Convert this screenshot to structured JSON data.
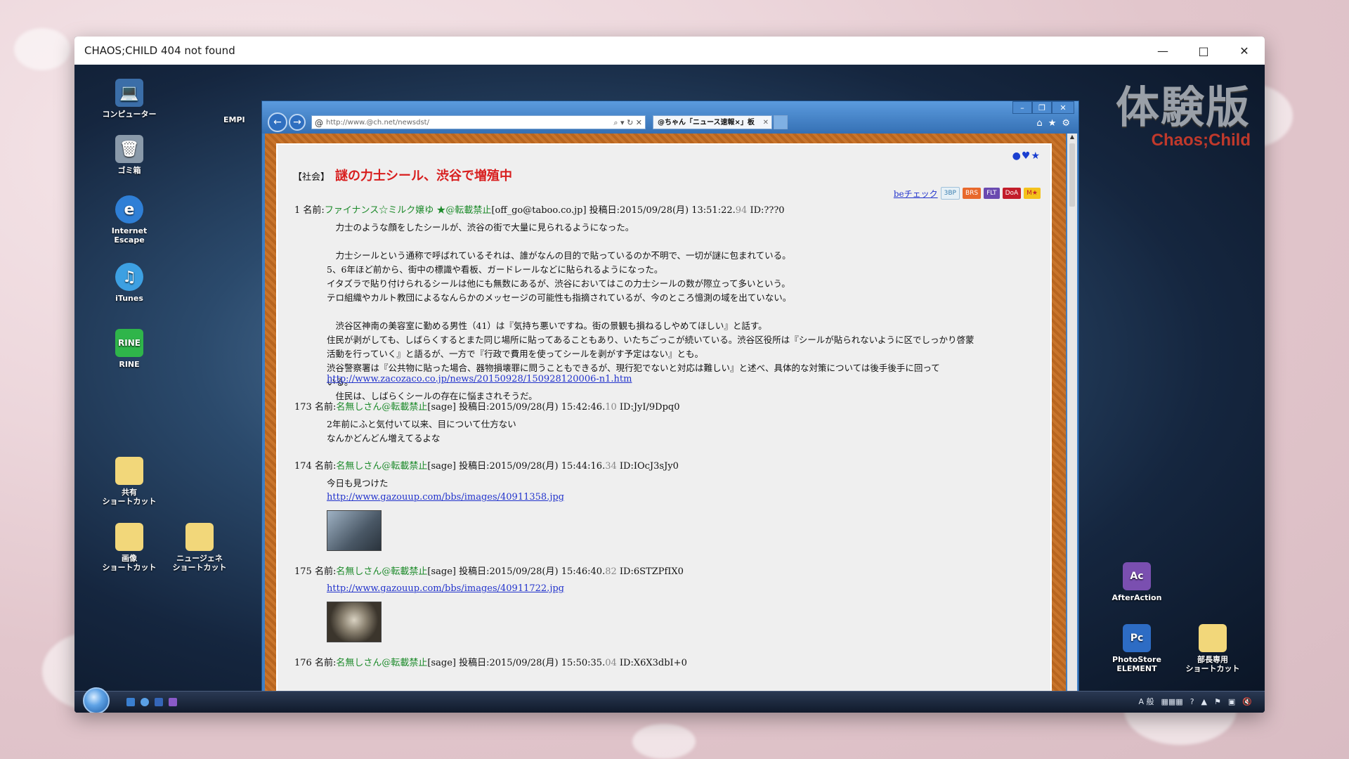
{
  "window": {
    "title": "CHAOS;CHILD 404 not found"
  },
  "watermark": {
    "main": "体験版",
    "sub": "Chaos;Child"
  },
  "desktop_icons": [
    {
      "label": "コンピューター",
      "icon": "computer-icon"
    },
    {
      "label": "ゴミ箱",
      "icon": "trash-icon"
    },
    {
      "label": "Internet Escape",
      "icon": "browser-icon"
    },
    {
      "label": "iTunes",
      "icon": "music-icon"
    },
    {
      "label": "RINE",
      "icon": "chat-icon"
    },
    {
      "label": "共有\nショートカット",
      "icon": "folder-icon"
    },
    {
      "label": "画像\nショートカット",
      "icon": "folder-icon"
    },
    {
      "label": "ニュージェネ\nショートカット",
      "icon": "folder-icon"
    },
    {
      "label": "EMPI",
      "icon": "folder-icon"
    },
    {
      "label": "AfterAction",
      "icon": "app-icon"
    },
    {
      "label": "PhotoStore\nELEMENT",
      "icon": "app-icon"
    },
    {
      "label": "部長専用\nショートカット",
      "icon": "folder-icon"
    }
  ],
  "browser": {
    "address": "http://www.@ch.net/newsdst/",
    "tab_label": "@ちゃん「ニュース速報×」板",
    "page": {
      "category": "【社会】",
      "title": "謎の力士シール、渋谷で増殖中",
      "be_check": "beチェック",
      "badges": [
        "3BP",
        "BRS",
        "FLT",
        "DoA",
        "M★"
      ],
      "posts": [
        {
          "num": "1",
          "name_label": "名前:",
          "name": "ファイナンス☆ミルク嬢ゆ ★@転載禁止",
          "mail": "[off_go@taboo.co.jp]",
          "date": "投稿日:2015/09/28(月) 13:51:22.",
          "sec": "94",
          "id": "ID:???0",
          "body": "　力士のような顔をしたシールが、渋谷の街で大量に見られるようになった。\n\n　力士シールという通称で呼ばれているそれは、誰がなんの目的で貼っているのか不明で、一切が謎に包まれている。\n5、6年ほど前から、街中の標識や看板、ガードレールなどに貼られるようになった。\nイタズラで貼り付けられるシールは他にも無数にあるが、渋谷においてはこの力士シールの数が際立って多いという。\nテロ組織やカルト教団によるなんらかのメッセージの可能性も指摘されているが、今のところ憶測の域を出ていない。\n\n　渋谷区神南の美容室に勤める男性（41）は『気持ち悪いですね。街の景観も損ねるしやめてほしい』と話す。\n住民が剥がしても、しばらくするとまた同じ場所に貼ってあることもあり、いたちごっこが続いている。渋谷区役所は『シールが貼られないように区でしっかり啓蒙\n活動を行っていく』と語るが、一方で『行政で費用を使ってシールを剥がす予定はない』とも。\n渋谷警察署は『公共物に貼った場合、器物損壊罪に問うこともできるが、現行犯でないと対応は難しい』と述べ、具体的な対策については後手後手に回って\nいる。\n　住民は、しばらくシールの存在に悩まされそうだ。",
          "link": "http://www.zacozaco.co.jp/news/20150928/150928120006-n1.htm"
        },
        {
          "num": "173",
          "name_label": "名前:",
          "name": "名無しさん@転載禁止",
          "mail": "[sage]",
          "date": "投稿日:2015/09/28(月) 15:42:46.",
          "sec": "10",
          "id": "ID:JyI/9Dpq0",
          "body": "2年前にふと気付いて以来、目について仕方ない\nなんかどんどん増えてるよな"
        },
        {
          "num": "174",
          "name_label": "名前:",
          "name": "名無しさん@転載禁止",
          "mail": "[sage]",
          "date": "投稿日:2015/09/28(月) 15:44:16.",
          "sec": "34",
          "id": "ID:IOcJ3sJy0",
          "body": "今日も見つけた",
          "link": "http://www.gazouup.com/bbs/images/40911358.jpg"
        },
        {
          "num": "175",
          "name_label": "名前:",
          "name": "名無しさん@転載禁止",
          "mail": "[sage]",
          "date": "投稿日:2015/09/28(月) 15:46:40.",
          "sec": "82",
          "id": "ID:6STZPfIX0",
          "link": "http://www.gazouup.com/bbs/images/40911722.jpg"
        },
        {
          "num": "176",
          "name_label": "名前:",
          "name": "名無しさん@転載禁止",
          "mail": "[sage]",
          "date": "投稿日:2015/09/28(月) 15:50:35.",
          "sec": "04",
          "id": "ID:X6X3dbI+0"
        }
      ]
    }
  },
  "taskbar": {
    "ime": "A 般"
  }
}
